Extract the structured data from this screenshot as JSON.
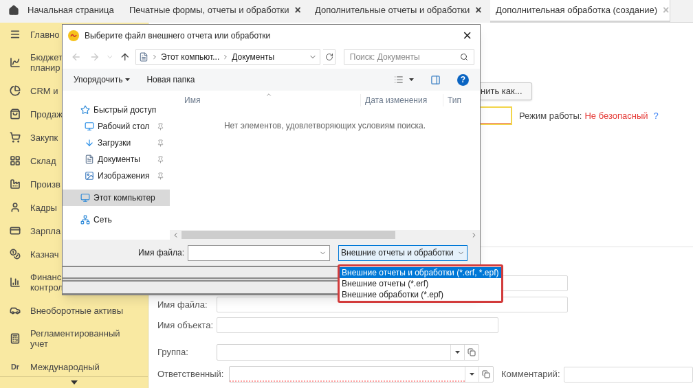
{
  "tabs": [
    {
      "kind": "home",
      "label": "Начальная страница",
      "selected": false
    },
    {
      "kind": "closable",
      "label": "Печатные формы, отчеты и обработки",
      "close": "×",
      "selected": false
    },
    {
      "kind": "closable",
      "label": "Дополнительные отчеты и обработки",
      "close": "×",
      "selected": false
    },
    {
      "kind": "closable",
      "label": "Дополнительная обработка (создание)",
      "close": "×",
      "selected": true
    }
  ],
  "sidebar": {
    "items": [
      {
        "lines": [
          "Главно"
        ]
      },
      {
        "lines": [
          "Бюджет",
          "планир"
        ]
      },
      {
        "lines": [
          "CRM и"
        ]
      },
      {
        "lines": [
          "Продаж"
        ]
      },
      {
        "lines": [
          "Закупк"
        ]
      },
      {
        "lines": [
          "Склад"
        ]
      },
      {
        "lines": [
          "Произв"
        ]
      },
      {
        "lines": [
          "Кадры"
        ]
      },
      {
        "lines": [
          "Зарпла"
        ]
      },
      {
        "lines": [
          "Казнач"
        ]
      },
      {
        "lines": [
          "Финанс",
          "контрол"
        ]
      },
      {
        "lines": [
          "Внеоборотные активы"
        ]
      },
      {
        "lines": [
          "Регламентированный",
          "учет"
        ]
      },
      {
        "badge": "Dr",
        "lines": [
          "Международный"
        ]
      }
    ]
  },
  "main": {
    "save_as_button": "нить как...",
    "mode_field": {
      "required": true
    },
    "mode_label": "Режим работы:",
    "mode_value": "Не безопасный",
    "mode_help": "?",
    "form": [
      {
        "kind": "text",
        "required": false
      },
      {
        "kind": "text",
        "label": "Имя файла:",
        "required": false
      },
      {
        "kind": "text",
        "label": "Имя объекта:",
        "required": false
      },
      {
        "kind": "select",
        "label": "Группа:",
        "required": false
      },
      {
        "kind": "select",
        "label": "Ответственный:",
        "required": true,
        "comment_label": "Комментарий:"
      }
    ]
  },
  "dialog": {
    "title": "Выберите файл внешнего отчета или обработки",
    "close": "×",
    "path": [
      "Этот компьют...",
      "Документы"
    ],
    "search": {
      "placeholder": "Поиск: Документы"
    },
    "toolbar": {
      "organize": "Упорядочить",
      "new_folder": "Новая папка",
      "help": "?"
    },
    "nav": [
      {
        "label": "Быстрый доступ",
        "pinned": false,
        "selected": false
      },
      {
        "label": "Рабочий стол",
        "pinned": true,
        "selected": false
      },
      {
        "label": "Загрузки",
        "pinned": true,
        "selected": false
      },
      {
        "label": "Документы",
        "pinned": true,
        "selected": false
      },
      {
        "label": "Изображения",
        "pinned": true,
        "selected": false
      },
      {
        "label": "Этот компьютер",
        "pinned": false,
        "selected": true
      },
      {
        "label": "Сеть",
        "pinned": false,
        "selected": false
      }
    ],
    "columns": [
      "Имя",
      "Дата изменения",
      "Тип"
    ],
    "empty_message": "Нет элементов, удовлетворяющих условиям поиска.",
    "file_name_label": "Имя файла:",
    "filter": "Внешние отчеты и обработки",
    "filter_options": [
      {
        "label": "Внешние отчеты и обработки (*.erf, *.epf)",
        "selected": true
      },
      {
        "label": "Внешние отчеты (*.erf)",
        "selected": false
      },
      {
        "label": "Внешние обработки (*.epf)",
        "selected": false
      }
    ]
  }
}
